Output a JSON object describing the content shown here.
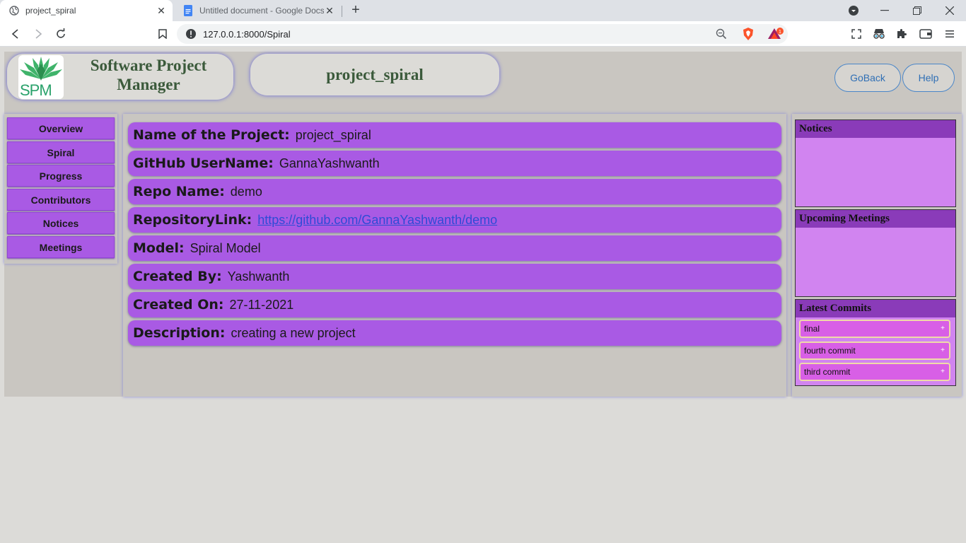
{
  "browser": {
    "tabs": [
      {
        "title": "project_spiral",
        "active": true
      },
      {
        "title": "Untitled document - Google Docs",
        "active": false
      }
    ],
    "url": "127.0.0.1:8000/Spiral",
    "badge_count": "1"
  },
  "header": {
    "logo_text": "SPM",
    "app_title_line1": "Software Project",
    "app_title_line2": "Manager",
    "project_name": "project_spiral",
    "goback_label": "GoBack",
    "help_label": "Help"
  },
  "sidebar": {
    "items": [
      {
        "label": "Overview"
      },
      {
        "label": "Spiral"
      },
      {
        "label": "Progress"
      },
      {
        "label": "Contributors"
      },
      {
        "label": "Notices"
      },
      {
        "label": "Meetings"
      }
    ]
  },
  "details": [
    {
      "label": "Name of the Project:",
      "value": "project_spiral"
    },
    {
      "label": "GitHub UserName:",
      "value": "GannaYashwanth"
    },
    {
      "label": "Repo Name:",
      "value": "demo"
    },
    {
      "label": "RepositoryLink:",
      "value": "https://github.com/GannaYashwanth/demo"
    },
    {
      "label": "Model:",
      "value": "Spiral Model"
    },
    {
      "label": "Created By:",
      "value": "Yashwanth"
    },
    {
      "label": "Created On:",
      "value": "27-11-2021"
    },
    {
      "label": "Description:",
      "value": "creating a new project"
    }
  ],
  "panels": {
    "notices_title": "Notices",
    "meetings_title": "Upcoming Meetings",
    "commits_title": "Latest Commits",
    "commits": [
      {
        "message": "final",
        "toggle": "+"
      },
      {
        "message": "fourth commit",
        "toggle": "+"
      },
      {
        "message": "third commit",
        "toggle": "+"
      }
    ]
  },
  "colors": {
    "accent_purple": "#a95ae4",
    "panel_head": "#8a3bb9",
    "panel_body": "#d184f0",
    "title_green": "#3b5a3b",
    "link_blue": "#2e4bd6"
  }
}
